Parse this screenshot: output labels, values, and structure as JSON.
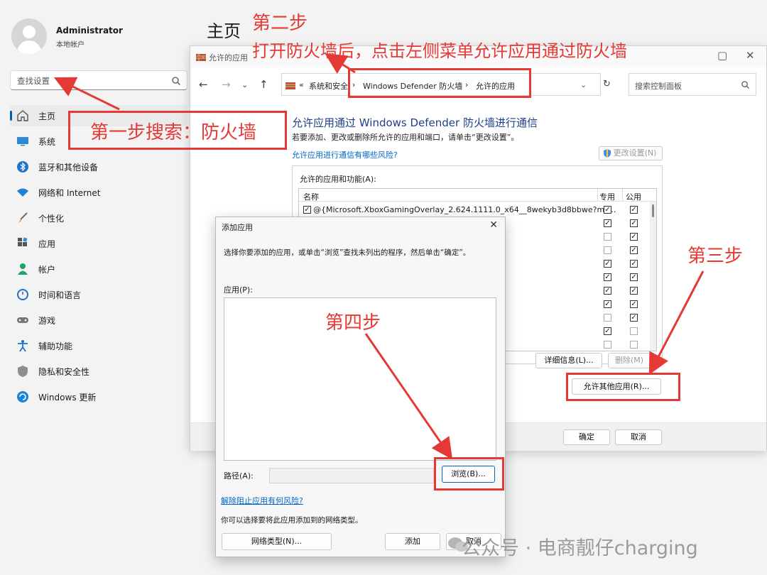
{
  "settings": {
    "user_name": "Administrator",
    "user_sub": "本地帐户",
    "search_placeholder": "查找设置",
    "page_title": "主页",
    "nav": [
      {
        "label": "主页",
        "icon": "home-icon"
      },
      {
        "label": "系统",
        "icon": "monitor-icon"
      },
      {
        "label": "蓝牙和其他设备",
        "icon": "bluetooth-icon"
      },
      {
        "label": "网络和 Internet",
        "icon": "wifi-icon"
      },
      {
        "label": "个性化",
        "icon": "brush-icon"
      },
      {
        "label": "应用",
        "icon": "apps-icon"
      },
      {
        "label": "帐户",
        "icon": "person-icon"
      },
      {
        "label": "时间和语言",
        "icon": "clock-globe-icon"
      },
      {
        "label": "游戏",
        "icon": "gamepad-icon"
      },
      {
        "label": "辅助功能",
        "icon": "accessibility-icon"
      },
      {
        "label": "隐私和安全性",
        "icon": "shield-icon"
      },
      {
        "label": "Windows 更新",
        "icon": "update-icon"
      }
    ]
  },
  "firewall": {
    "window_title": "允许的应用",
    "breadcrumb_prefix": "«",
    "breadcrumb": [
      "系统和安全",
      "Windows Defender 防火墙",
      "允许的应用"
    ],
    "search_placeholder": "搜索控制面板",
    "heading": "允许应用通过 Windows Defender 防火墙进行通信",
    "description": "若要添加、更改或删除所允许的应用和端口，请单击“更改设置”。",
    "risk_link": "允许应用进行通信有哪些风险?",
    "change_settings": "更改设置(N)",
    "group_label": "允许的应用和功能(A):",
    "columns": {
      "name": "名称",
      "private": "专用",
      "public": "公用"
    },
    "first_row_name": "@{Microsoft.XboxGamingOverlay_2.624.1111.0_x64__8wekyb3d8bbwe?ms...",
    "rows": [
      {
        "enabled": true,
        "private": true,
        "public": true
      },
      {
        "enabled": null,
        "private": true,
        "public": true
      },
      {
        "enabled": null,
        "private": false,
        "public": true
      },
      {
        "enabled": null,
        "private": false,
        "public": true
      },
      {
        "enabled": null,
        "private": true,
        "public": true
      },
      {
        "enabled": null,
        "private": true,
        "public": true
      },
      {
        "enabled": null,
        "private": true,
        "public": true
      },
      {
        "enabled": null,
        "private": true,
        "public": true
      },
      {
        "enabled": null,
        "private": false,
        "public": true
      },
      {
        "enabled": null,
        "private": true,
        "public": false
      },
      {
        "enabled": null,
        "private": false,
        "public": false
      }
    ],
    "details_button": "详细信息(L)...",
    "remove_button": "删除(M)",
    "allow_other_button": "允许其他应用(R)...",
    "ok_button": "确定",
    "cancel_button": "取消"
  },
  "dialog": {
    "title": "添加应用",
    "description": "选择你要添加的应用，或单击“浏览”查找未列出的程序，然后单击“确定”。",
    "apps_label": "应用(P):",
    "path_label": "路径(A):",
    "browse_button": "浏览(B)...",
    "risk_link": "解除阻止应用有何风险?",
    "note": "你可以选择要将此应用添加到的网络类型。",
    "network_type_button": "网络类型(N)...",
    "add_button": "添加",
    "cancel_button": "取消"
  },
  "annotations": {
    "step1": "第一步搜索：防火墙",
    "step2_title": "第二步",
    "step2_text": "打开防火墙后，点击左侧菜单允许应用通过防火墙",
    "step3": "第三步",
    "step4": "第四步",
    "color": "#e53935"
  },
  "watermark": "公众号 · 电商靓仔charging"
}
